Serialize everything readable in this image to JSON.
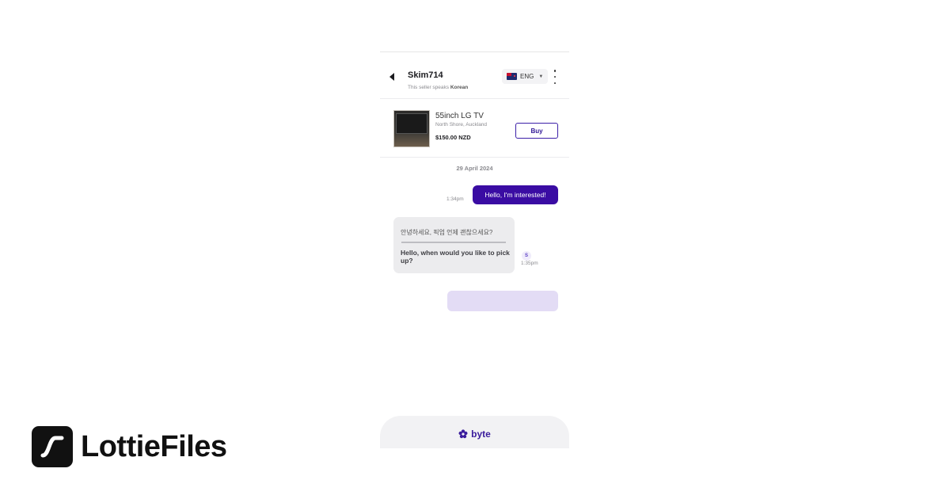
{
  "header": {
    "back_icon": "caret-left-icon",
    "seller_name": "Skim714",
    "seller_sub_prefix": "This seller speaks ",
    "seller_language": "Korean",
    "language_select": {
      "flag_icon": "new-zealand-flag-icon",
      "value": "ENG",
      "caret_icon": "caret-down-icon"
    },
    "more_icon": "more-vertical-icon"
  },
  "listing": {
    "title": "55inch LG TV",
    "location": "North Shore, Auckland",
    "price": "$150.00 NZD",
    "buy_label": "Buy"
  },
  "chat": {
    "date": "29 April 2024",
    "messages": [
      {
        "direction": "out",
        "text": "Hello, I'm interested!",
        "time": "1:34pm"
      },
      {
        "direction": "in",
        "original": "안녕하세요, 픽업 언제 괜찮으세요?",
        "translation": "Hello, when would you like to pick up?",
        "time": "1:35pm",
        "avatar_initial": "S"
      }
    ]
  },
  "footer": {
    "brand_icon": "flower-icon",
    "brand_name": "byte"
  },
  "branding": {
    "logo_icon": "lottiefiles-logo-icon",
    "wordmark": "LottieFiles"
  },
  "colors": {
    "primary": "#3a0ca3",
    "bubble_in": "#ececee",
    "typing": "#e3dcf5",
    "brand_text": "#3a1c9c"
  }
}
